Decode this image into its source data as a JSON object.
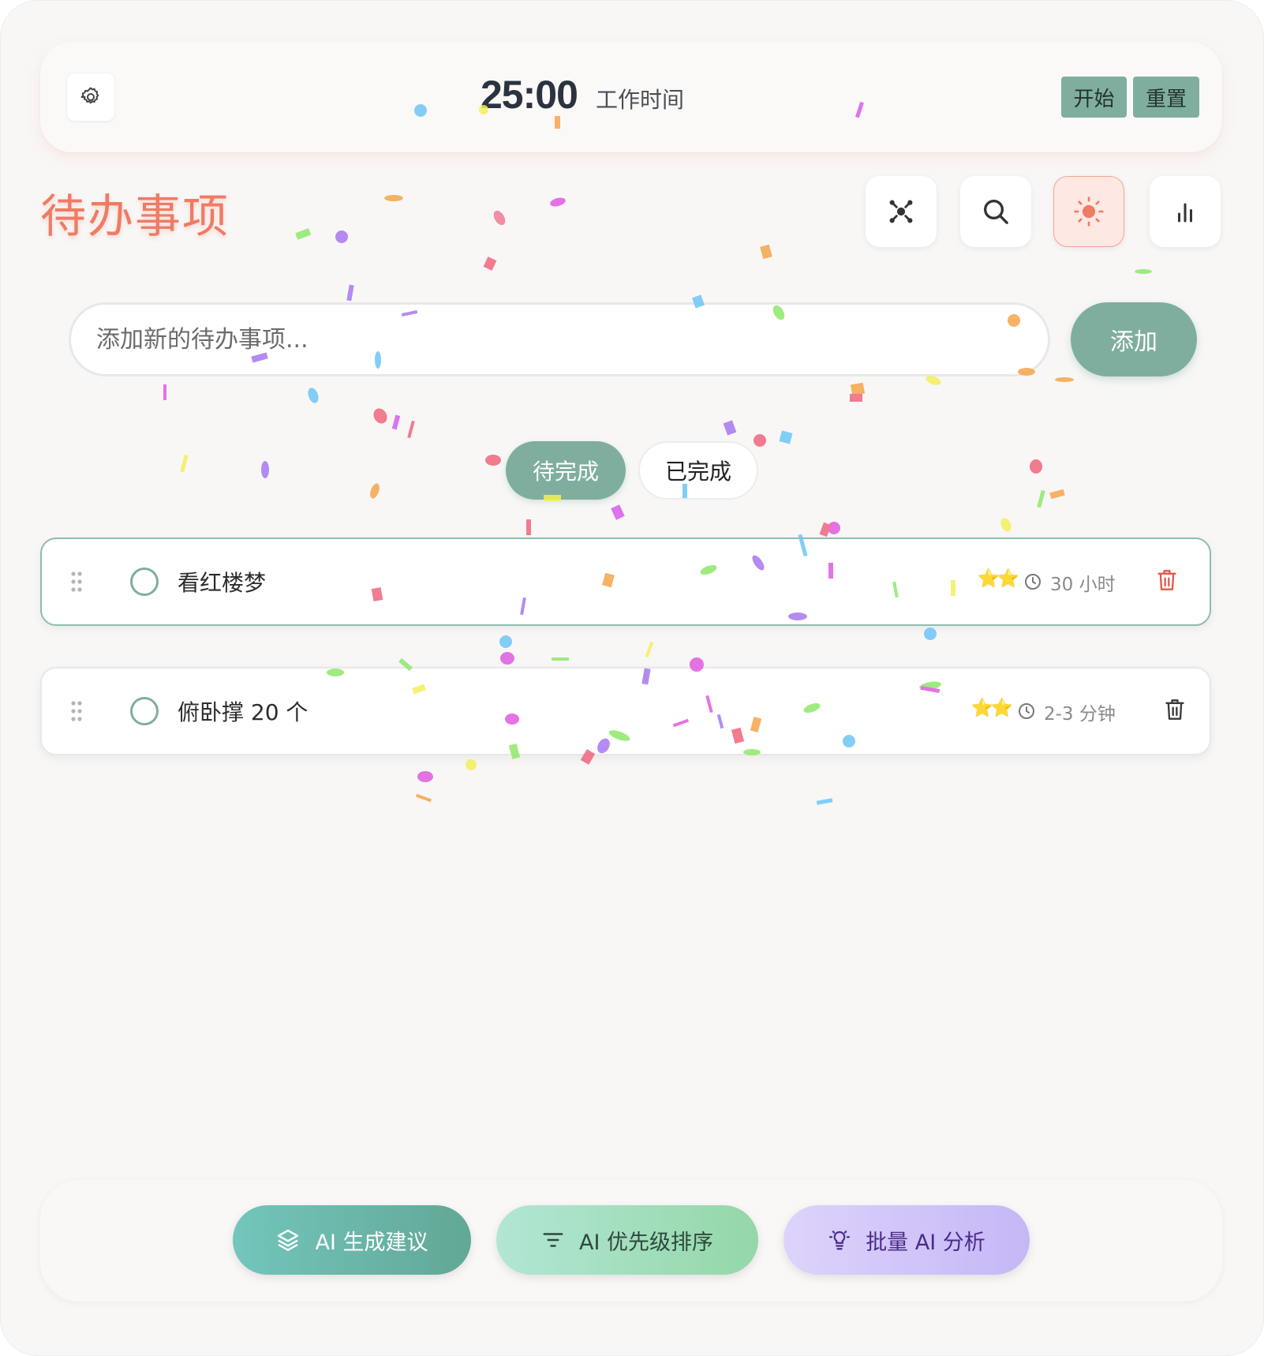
{
  "timer": {
    "time": "25:00",
    "mode": "工作时间",
    "start_label": "开始",
    "reset_label": "重置"
  },
  "header": {
    "title": "待办事项",
    "tools": [
      {
        "icon": "focus-icon"
      },
      {
        "icon": "search-icon"
      },
      {
        "icon": "sun-icon",
        "active": true
      },
      {
        "icon": "chart-icon"
      }
    ]
  },
  "add_form": {
    "placeholder": "添加新的待办事项...",
    "button_label": "添加"
  },
  "filters": {
    "pending": "待完成",
    "done": "已完成",
    "active": "pending"
  },
  "todos": [
    {
      "text": "看红楼梦",
      "stars": "⭐⭐",
      "duration": "30 小时",
      "trash_color": "#e05a4c"
    },
    {
      "text": "俯卧撑 20 个",
      "stars": "⭐⭐",
      "duration": "2-3 分钟",
      "trash_color": "#3a3a3a"
    }
  ],
  "actions": {
    "generate": "AI 生成建议",
    "prioritize": "AI 优先级排序",
    "batch": "批量 AI 分析"
  },
  "colors": {
    "accent": "#7fae9f",
    "title": "#f07b64",
    "active_tool": "#f07b64"
  }
}
